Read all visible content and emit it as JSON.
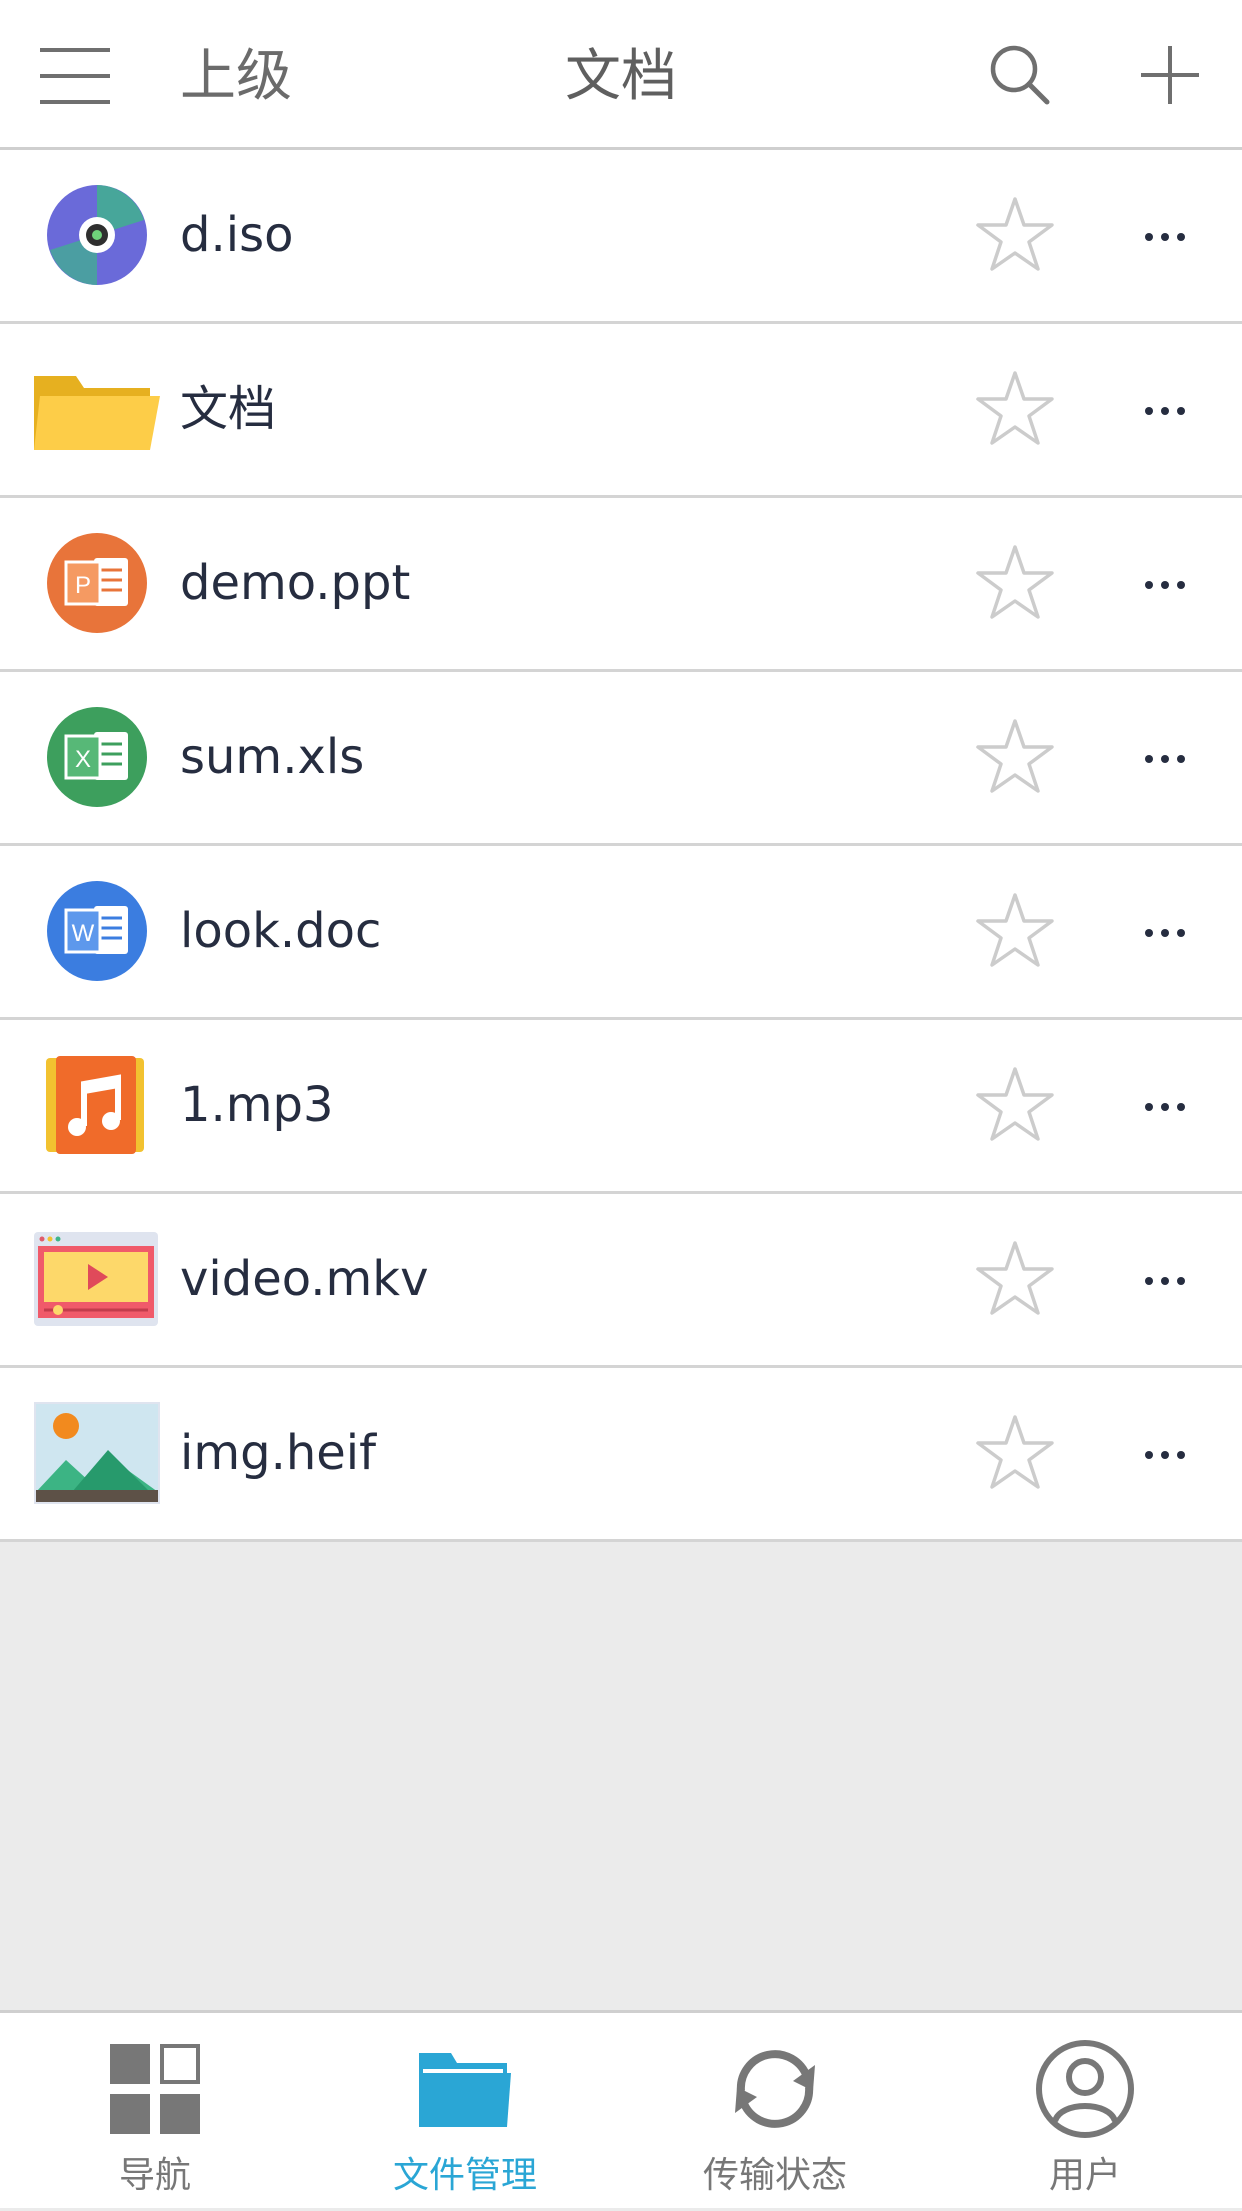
{
  "header": {
    "menu_icon": "hamburger-icon",
    "up_label": "上级",
    "title": "文档",
    "search_icon": "search-icon",
    "add_icon": "plus-icon"
  },
  "files": [
    {
      "name": "d.iso",
      "icon": "disc-icon",
      "starred": false
    },
    {
      "name": "文档",
      "icon": "folder-icon",
      "starred": false
    },
    {
      "name": "demo.ppt",
      "icon": "powerpoint-icon",
      "starred": false
    },
    {
      "name": "sum.xls",
      "icon": "excel-icon",
      "starred": false
    },
    {
      "name": "look.doc",
      "icon": "word-icon",
      "starred": false
    },
    {
      "name": "1.mp3",
      "icon": "music-icon",
      "starred": false
    },
    {
      "name": "video.mkv",
      "icon": "video-icon",
      "starred": false
    },
    {
      "name": "img.heif",
      "icon": "image-icon",
      "starred": false
    }
  ],
  "tabs": [
    {
      "label": "导航",
      "icon": "grid-icon",
      "active": false
    },
    {
      "label": "文件管理",
      "icon": "folder-icon",
      "active": true
    },
    {
      "label": "传输状态",
      "icon": "sync-icon",
      "active": false
    },
    {
      "label": "用户",
      "icon": "user-icon",
      "active": false
    }
  ],
  "colors": {
    "accent": "#2aa6d5",
    "inactive": "#777777",
    "text": "#262d40",
    "background": "#ebebeb"
  }
}
